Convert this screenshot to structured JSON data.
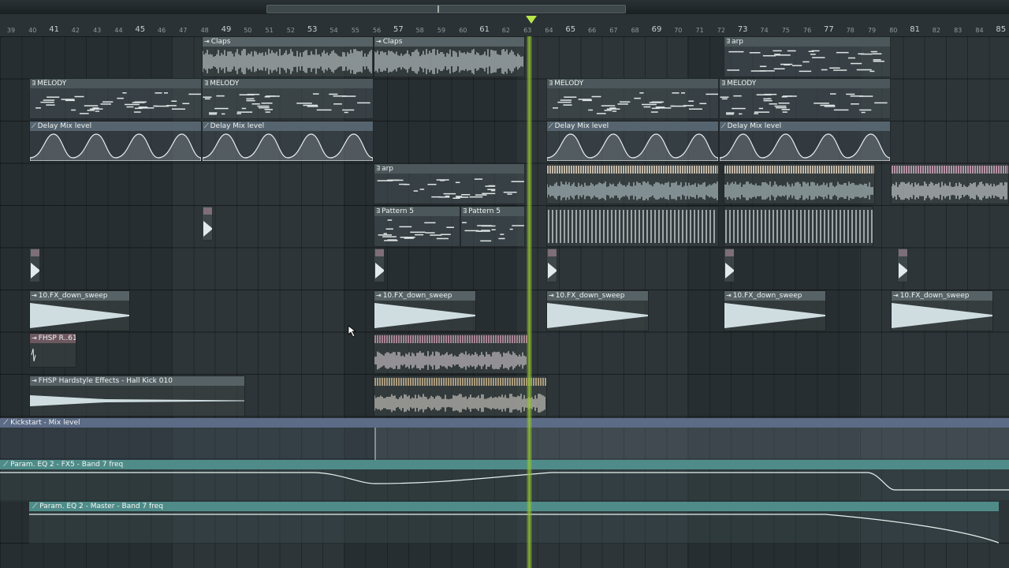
{
  "ruler": {
    "bars": [
      {
        "label": "39",
        "major": false
      },
      {
        "label": "40",
        "major": false
      },
      {
        "label": "41",
        "major": true
      },
      {
        "label": "42",
        "major": false
      },
      {
        "label": "43",
        "major": false
      },
      {
        "label": "44",
        "major": false
      },
      {
        "label": "45",
        "major": true
      },
      {
        "label": "46",
        "major": false
      },
      {
        "label": "47",
        "major": false
      },
      {
        "label": "48",
        "major": false
      },
      {
        "label": "49",
        "major": true
      },
      {
        "label": "50",
        "major": false
      },
      {
        "label": "51",
        "major": false
      },
      {
        "label": "52",
        "major": false
      },
      {
        "label": "53",
        "major": true
      },
      {
        "label": "54",
        "major": false
      },
      {
        "label": "55",
        "major": false
      },
      {
        "label": "56",
        "major": false
      },
      {
        "label": "57",
        "major": true
      },
      {
        "label": "58",
        "major": false
      },
      {
        "label": "59",
        "major": false
      },
      {
        "label": "60",
        "major": false
      },
      {
        "label": "61",
        "major": true
      },
      {
        "label": "62",
        "major": false
      },
      {
        "label": "63",
        "major": false
      },
      {
        "label": "64",
        "major": false
      },
      {
        "label": "65",
        "major": true
      },
      {
        "label": "66",
        "major": false
      },
      {
        "label": "67",
        "major": false
      },
      {
        "label": "68",
        "major": false
      },
      {
        "label": "69",
        "major": true
      },
      {
        "label": "70",
        "major": false
      },
      {
        "label": "71",
        "major": false
      },
      {
        "label": "72",
        "major": false
      },
      {
        "label": "73",
        "major": true
      },
      {
        "label": "74",
        "major": false
      },
      {
        "label": "75",
        "major": false
      },
      {
        "label": "76",
        "major": false
      },
      {
        "label": "77",
        "major": true
      },
      {
        "label": "78",
        "major": false
      },
      {
        "label": "79",
        "major": false
      },
      {
        "label": "80",
        "major": false
      },
      {
        "label": "81",
        "major": true
      },
      {
        "label": "82",
        "major": false
      },
      {
        "label": "83",
        "major": false
      },
      {
        "label": "84",
        "major": false
      },
      {
        "label": "85",
        "major": true
      }
    ]
  },
  "tracks": {
    "claps": {
      "label": "Claps"
    },
    "arp": {
      "label": "arp"
    },
    "melody": {
      "label": "MELODY"
    },
    "delay_mix": {
      "label": "Delay Mix level"
    },
    "pattern5": {
      "label": "Pattern 5"
    },
    "fx_sweep": {
      "label": "10.FX_down_sweep"
    },
    "fhsp_r": {
      "label": "FHSP R..61"
    },
    "hall_kick": {
      "label": "FHSP Hardstyle Effects - Hall Kick 010"
    }
  },
  "automation_lanes": {
    "kickstart": {
      "label": "Kickstart - Mix level"
    },
    "eq_fx5": {
      "label": "Param. EQ 2 - FX5 - Band 7 freq"
    },
    "eq_master": {
      "label": "Param. EQ 2 - Master - Band 7 freq"
    }
  },
  "colors": {
    "background": "#2d3538",
    "playhead": "#9ccc3a",
    "waveform": "#dfe8ea",
    "pink_clip": "#d9b9c6",
    "tan_clip": "#e2d2b8",
    "lane_teal": "#4f8c89",
    "lane_blue": "#5c6b86"
  },
  "icons": {
    "automation": "automation-icon",
    "pattern": "pattern-icon",
    "audio": "audio-clip-icon",
    "playhead": "playhead-marker-icon",
    "cursor": "move-cursor-icon"
  }
}
